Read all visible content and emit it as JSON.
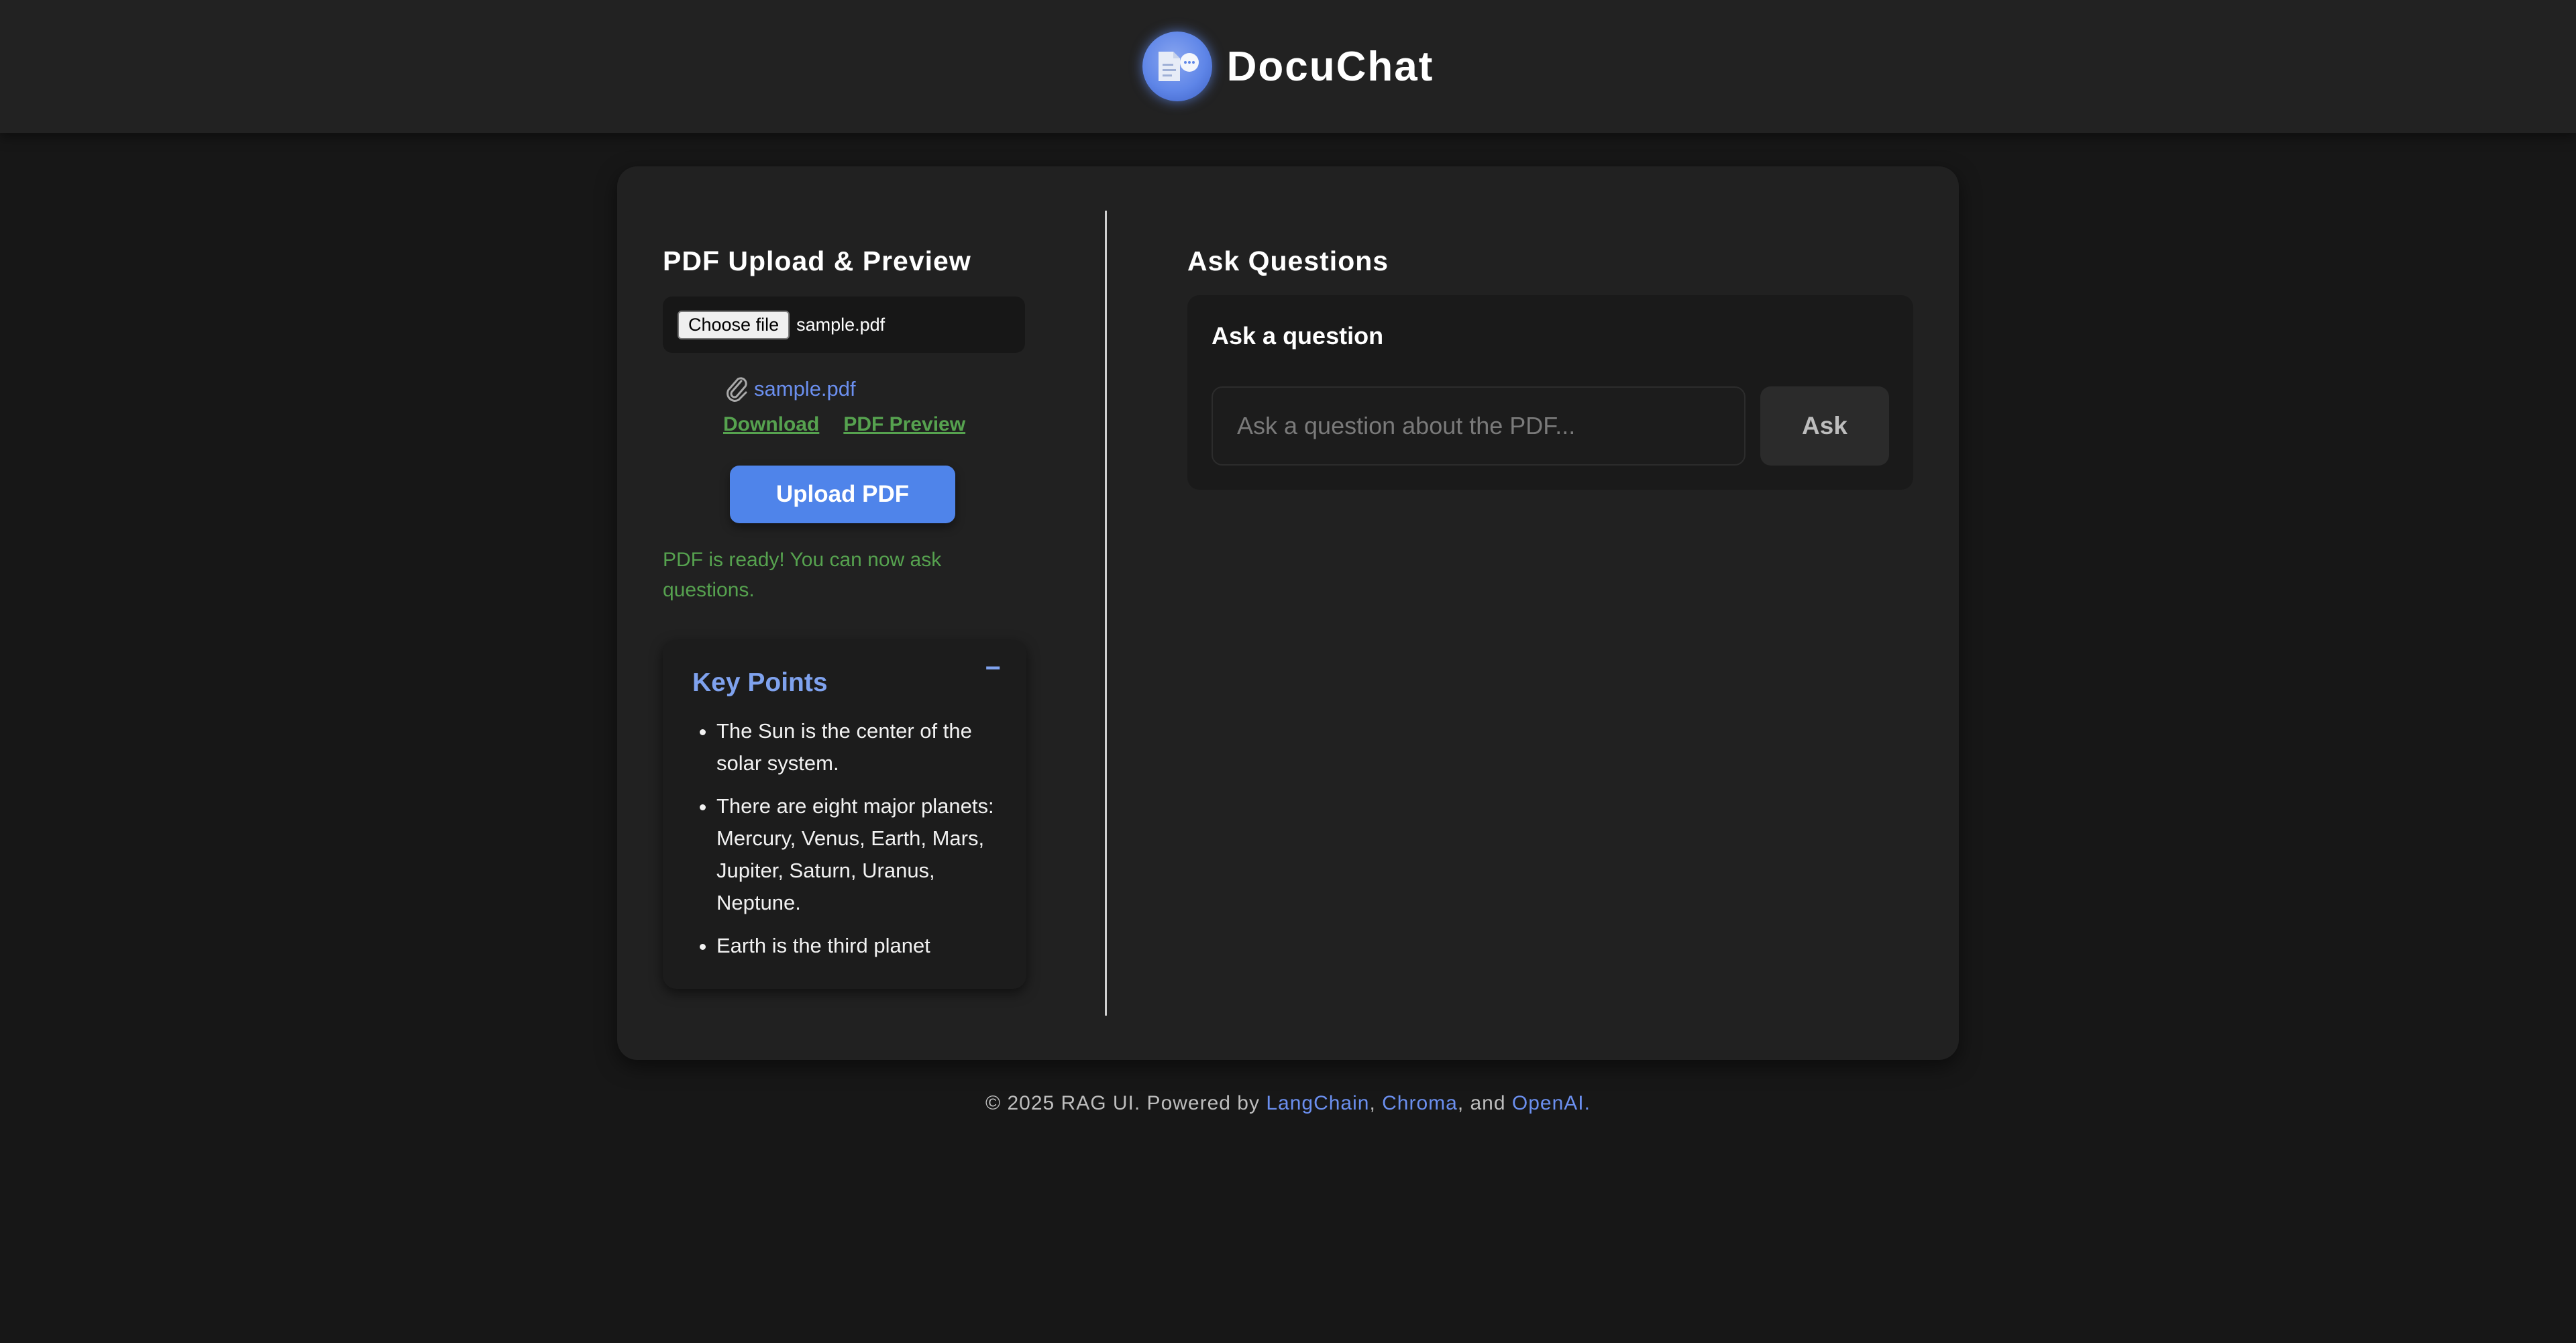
{
  "header": {
    "app_title": "DocuChat",
    "logo_icon": "document-chat-icon"
  },
  "upload_panel": {
    "title": "PDF Upload & Preview",
    "choose_file_label": "Choose file",
    "selected_file": "sample.pdf",
    "attached_file_link": "sample.pdf",
    "download_link": "Download",
    "preview_link": "PDF Preview",
    "upload_button": "Upload PDF",
    "status_message": "PDF is ready! You can now ask questions."
  },
  "key_points": {
    "title": "Key Points",
    "collapse_symbol": "−",
    "items": [
      "The Sun is the center of the solar system.",
      "There are eight major planets: Mercury, Venus, Earth, Mars, Jupiter, Saturn, Uranus, Neptune.",
      "Earth is the third planet"
    ]
  },
  "ask_panel": {
    "title": "Ask Questions",
    "label": "Ask a question",
    "input_placeholder": "Ask a question about the PDF...",
    "input_value": "",
    "ask_button": "Ask"
  },
  "footer": {
    "prefix": "© 2025 RAG UI. Powered by ",
    "link1": "LangChain",
    "sep1": ", ",
    "link2": "Chroma",
    "sep2": ", and ",
    "link3": "OpenAI",
    "suffix": "."
  },
  "colors": {
    "accent_blue": "#4f84ea",
    "link_blue": "#6b8fef",
    "success_green": "#56a24f",
    "background": "#171717",
    "card": "#212121"
  }
}
